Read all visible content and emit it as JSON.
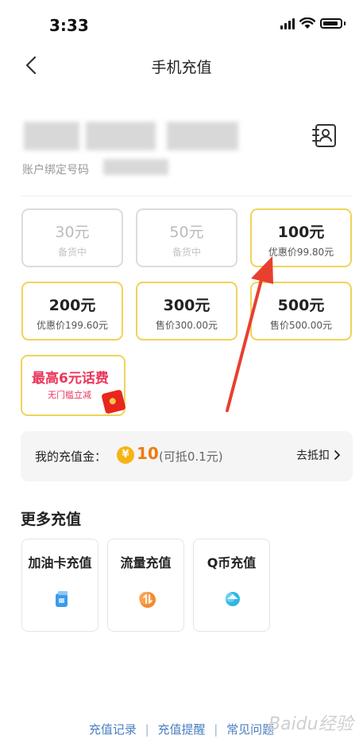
{
  "status_bar": {
    "time": "3:33"
  },
  "header": {
    "title": "手机充值"
  },
  "account": {
    "binding_label": "账户绑定号码"
  },
  "recharge_options": [
    {
      "amount": "30元",
      "note": "备货中",
      "state": "disabled"
    },
    {
      "amount": "50元",
      "note": "备货中",
      "state": "disabled"
    },
    {
      "amount": "100元",
      "note": "优惠价99.80元",
      "state": "selectable"
    },
    {
      "amount": "200元",
      "note": "优惠价199.60元",
      "state": "selectable"
    },
    {
      "amount": "300元",
      "note": "售价300.00元",
      "state": "selectable"
    },
    {
      "amount": "500元",
      "note": "售价500.00元",
      "state": "selectable"
    }
  ],
  "promo": {
    "title": "最高6元话费",
    "subtitle": "无门槛立减"
  },
  "gold": {
    "label": "我的充值金：",
    "coin_symbol": "¥",
    "amount": "10",
    "note": "(可抵0.1元)",
    "action": "去抵扣"
  },
  "more": {
    "title": "更多充值",
    "services": [
      {
        "label": "加油卡充值",
        "icon": "fuel-card-icon"
      },
      {
        "label": "流量充值",
        "icon": "data-traffic-icon"
      },
      {
        "label": "Q币充值",
        "icon": "q-coin-icon"
      }
    ]
  },
  "footer": {
    "link1": "充值记录",
    "link2": "充值提醒",
    "link3": "常见问题",
    "separator": "|"
  },
  "watermark": "Baidu经验",
  "colors": {
    "card_border_active": "#f1d25a",
    "promo_red": "#e9365b",
    "gold_orange": "#ef7a10",
    "link_blue": "#4a7fc1",
    "annotation_arrow": "#e8402f"
  }
}
